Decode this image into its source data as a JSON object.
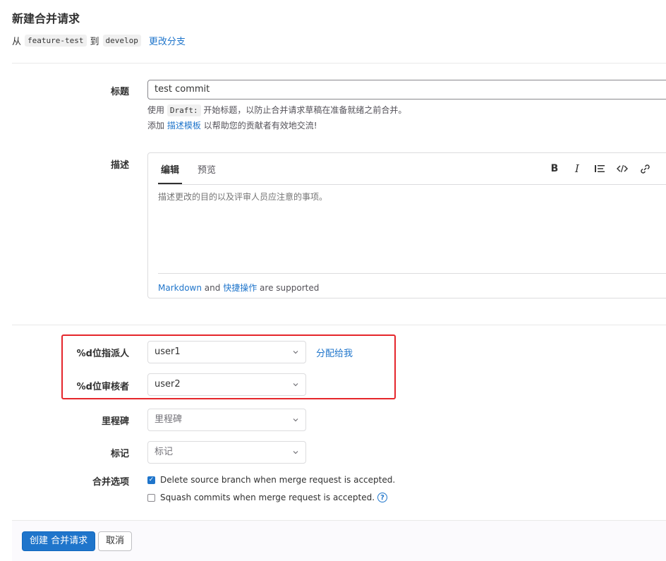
{
  "header": {
    "title": "新建合并请求",
    "from_word": "从",
    "source_branch": "feature-test",
    "to_word": "到",
    "target_branch": "develop",
    "change_branches_link": "更改分支"
  },
  "form": {
    "title_label": "标题",
    "title_value": "test commit",
    "title_help_prefix": "使用",
    "title_help_code": "Draft:",
    "title_help_suffix": "开始标题，以防止合并请求草稿在准备就绪之前合并。",
    "template_help_prefix": "添加",
    "template_help_link": "描述模板",
    "template_help_suffix": "以帮助您的贡献者有效地交流!",
    "description_label": "描述",
    "editor": {
      "tab_write": "编辑",
      "tab_preview": "预览",
      "placeholder": "描述更改的目的以及评审人员应注意的事项。",
      "toolbar": [
        "bold-icon",
        "italic-icon",
        "list-icon",
        "code-icon",
        "link-icon",
        "more-icon"
      ],
      "footer_markdown_link": "Markdown",
      "footer_and": "and",
      "footer_quick_actions_link": "快捷操作",
      "footer_supported": "are supported"
    },
    "assignee_label": "%d位指派人",
    "assignee_value": "user1",
    "assign_to_me_link": "分配给我",
    "reviewer_label": "%d位审核者",
    "reviewer_value": "user2",
    "milestone_label": "里程碑",
    "milestone_value": "里程碑",
    "labels_label": "标记",
    "labels_value": "标记",
    "merge_options_label": "合并选项",
    "delete_source_branch": "Delete source branch when merge request is accepted.",
    "delete_source_branch_checked": true,
    "squash_commits": "Squash commits when merge request is accepted.",
    "squash_commits_checked": false
  },
  "actions": {
    "create_label": "创建 合并请求",
    "cancel_label": "取消"
  },
  "colors": {
    "primary": "#1f75cb",
    "highlight_border": "#e5262b"
  }
}
